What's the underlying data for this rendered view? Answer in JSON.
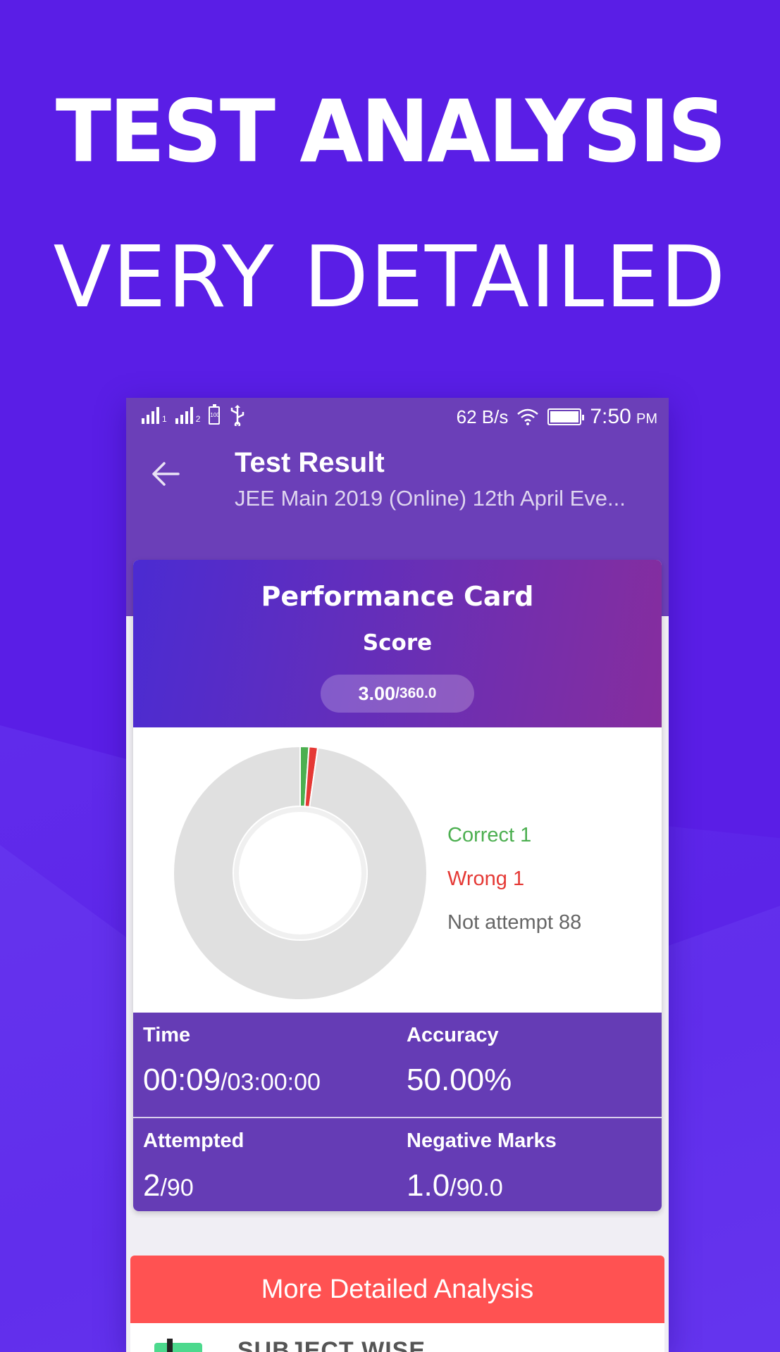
{
  "hero": {
    "title": "TEST ANALYSIS",
    "subtitle": "VERY DETAILED"
  },
  "status_bar": {
    "sim1": "1",
    "sim2": "2",
    "battery_level_label": "100",
    "net_speed": "62 B/s",
    "time": "7:50",
    "ampm": "PM",
    "icons": [
      "signal-icon",
      "signal-icon",
      "battery-icon",
      "usb-icon",
      "wifi-icon",
      "battery-icon"
    ]
  },
  "toolbar": {
    "title": "Test Result",
    "subtitle": "JEE Main 2019 (Online) 12th April Eve..."
  },
  "performance_card": {
    "title": "Performance Card",
    "score_label": "Score",
    "score": "3.00",
    "score_total": "/360.0"
  },
  "chart_data": {
    "type": "pie",
    "categories": [
      "Correct",
      "Wrong",
      "Not attempt"
    ],
    "values": [
      1,
      1,
      88
    ],
    "colors": [
      "#4caf50",
      "#e53935",
      "#e0e0e0"
    ]
  },
  "legend": {
    "correct": "Correct 1",
    "wrong": "Wrong 1",
    "not_attempt": "Not attempt 88"
  },
  "stats": {
    "time": {
      "label": "Time",
      "value": "00:09",
      "total": "/03:00:00"
    },
    "accuracy": {
      "label": "Accuracy",
      "value": "50.00%"
    },
    "attempted": {
      "label": "Attempted",
      "value": "2",
      "total": "/90"
    },
    "negative": {
      "label": "Negative Marks",
      "value": "1.0",
      "total": "/90.0"
    }
  },
  "more_button": {
    "label": "More Detailed Analysis"
  },
  "next_section": {
    "label": "SUBJECT WISE"
  },
  "colors": {
    "background": "#5a1ee6",
    "appbar": "#6b3fb8",
    "stats_panel": "#653cb5",
    "button": "#ff5252",
    "correct": "#4caf50",
    "wrong": "#e53935"
  }
}
